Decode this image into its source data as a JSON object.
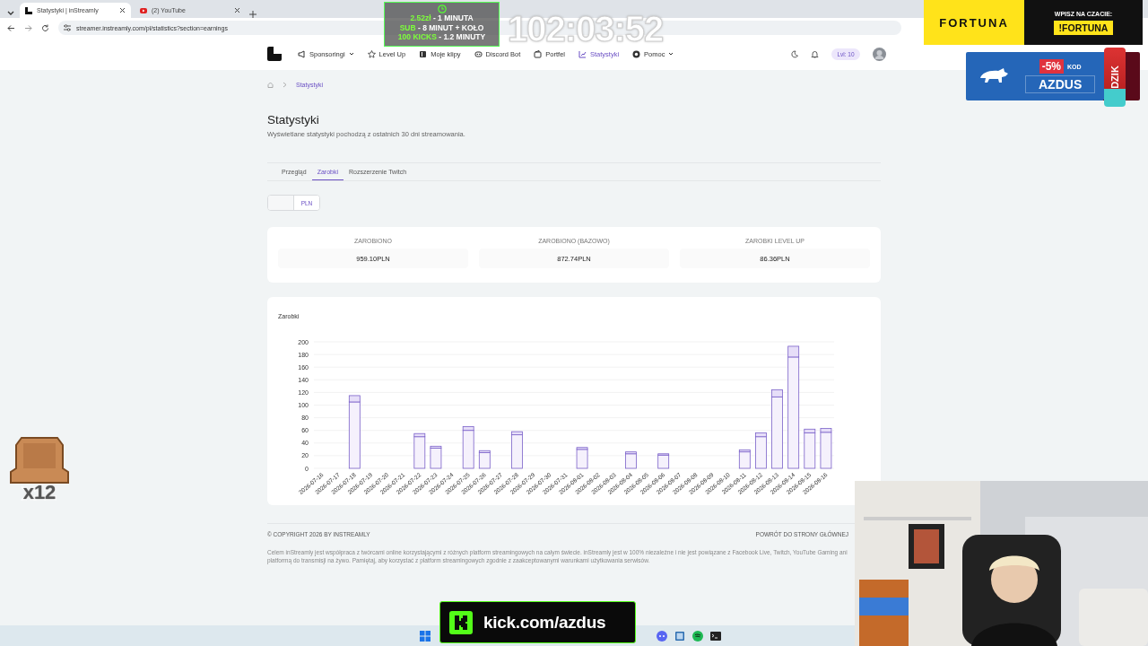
{
  "browser": {
    "tabs": [
      {
        "title": "Statystyki | inStreamly",
        "kind": "site",
        "selected": true
      },
      {
        "title": "(2) YouTube",
        "kind": "video",
        "selected": false
      }
    ],
    "url": "streamer.instreamly.com/pl/statistics?section=earnings"
  },
  "nav": {
    "items": [
      {
        "label": "Sponsoringi",
        "dropdown": true,
        "selected": false
      },
      {
        "label": "Level Up",
        "dropdown": false,
        "selected": false
      },
      {
        "label": "Moje klipy",
        "dropdown": false,
        "selected": false
      },
      {
        "label": "Discord Bot",
        "dropdown": false,
        "selected": false
      },
      {
        "label": "Portfel",
        "dropdown": false,
        "selected": false
      },
      {
        "label": "Statystyki",
        "dropdown": false,
        "selected": true
      },
      {
        "label": "Pomoc",
        "dropdown": true,
        "selected": false
      }
    ],
    "level_badge": "Lvl: 10"
  },
  "breadcrumb": {
    "current": "Statystyki"
  },
  "page": {
    "title": "Statystyki",
    "subtitle": "Wyświetlane statystyki pochodzą z ostatnich 30 dni streamowania."
  },
  "tabs": [
    {
      "label": "Przegląd",
      "selected": false
    },
    {
      "label": "Zarobki",
      "selected": true
    },
    {
      "label": "Rozszerzenie Twitch",
      "selected": false
    }
  ],
  "currency_options": [
    {
      "kind": "blank",
      "selected": false
    },
    {
      "kind": "text",
      "label": "PLN",
      "selected": true
    }
  ],
  "stats": [
    {
      "label": "ZAROBIONO",
      "value": "959.10PLN"
    },
    {
      "label": "ZAROBIONO (BAZOWO)",
      "value": "872.74PLN"
    },
    {
      "label": "ZAROBKI LEVEL UP",
      "value": "86.36PLN"
    }
  ],
  "chart": {
    "title": "Zarobki",
    "chart_data": {
      "type": "bar",
      "stacked": true,
      "grid": true,
      "ylim": [
        0,
        200
      ],
      "yticks": [
        0,
        20,
        40,
        60,
        80,
        100,
        120,
        140,
        160,
        180,
        200
      ],
      "categories": [
        "2026-07-16",
        "2026-07-17",
        "2026-07-18",
        "2026-07-19",
        "2026-07-20",
        "2026-07-21",
        "2026-07-22",
        "2026-07-23",
        "2026-07-24",
        "2026-07-25",
        "2026-07-26",
        "2026-07-27",
        "2026-07-28",
        "2026-07-29",
        "2026-07-30",
        "2026-07-31",
        "2026-08-01",
        "2026-08-02",
        "2026-08-03",
        "2026-08-04",
        "2026-08-05",
        "2026-08-06",
        "2026-08-07",
        "2026-08-08",
        "2026-08-09",
        "2026-08-10",
        "2026-08-11",
        "2026-08-12",
        "2026-08-13",
        "2026-08-14",
        "2026-08-15",
        "2026-08-16"
      ],
      "series": [
        {
          "color": "#f5f1fc",
          "values": [
            null,
            null,
            105,
            null,
            null,
            null,
            50,
            32,
            null,
            60,
            25,
            null,
            53,
            null,
            null,
            null,
            30,
            null,
            null,
            23,
            null,
            21,
            null,
            null,
            null,
            null,
            26,
            50,
            113,
            176,
            56,
            57
          ]
        },
        {
          "color": "#e6def8",
          "values": [
            null,
            null,
            10,
            null,
            null,
            null,
            5,
            3,
            null,
            6,
            3,
            null,
            5,
            null,
            null,
            null,
            3,
            null,
            null,
            3,
            null,
            2,
            null,
            null,
            null,
            null,
            3,
            6,
            11,
            17,
            6,
            6
          ]
        }
      ]
    }
  },
  "footer": {
    "copyright": "© COPYRIGHT 2026 BY INSTREAMLY",
    "back_link": "POWRÓT DO STRONY GŁÓWNEJ",
    "disclaimer": "Celem inStreamly jest współpraca z twórcami online korzystającymi z różnych platform streamingowych na całym świecie. inStreamly jest w 100% niezależne i nie jest powiązane z Facebook Live, Twitch, YouTube Gaming ani platformą do transmisji na żywo. Pamiętaj, aby korzystać z platform streamingowych zgodnie z zaakceptowanymi warunkami użytkowania serwisów."
  },
  "overlays": {
    "goals": [
      {
        "highlight": "2.52zł",
        "text": "- 1 MINUTA"
      },
      {
        "highlight": "SUB",
        "text": "- 8 MINUT + KOŁO"
      },
      {
        "highlight": "100 KICKS",
        "text": "- 1.2 MINUTY"
      }
    ],
    "timer": "102:03:52",
    "fortuna": {
      "brand": "FORTUNA",
      "prompt": "WPISZ NA CZACIE:",
      "command": "!FORTUNA"
    },
    "dzik": {
      "discount": "-5%",
      "code_label": "KOD",
      "code": "AZDUS",
      "can": "DZIK"
    },
    "counter": "x12",
    "kick": "kick.com/azdus"
  }
}
